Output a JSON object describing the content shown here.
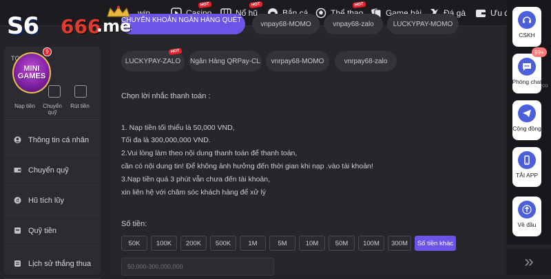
{
  "nav": {
    "logo": {
      "part1": "S6",
      "part2": "666",
      "part3": ".me"
    },
    "items": [
      {
        "label": "win",
        "icon": "slot-icon",
        "hot": false
      },
      {
        "label": "Casino",
        "icon": "play-icon",
        "hot": true
      },
      {
        "label": "Nổ hũ",
        "icon": "slot-icon",
        "hot": true
      },
      {
        "label": "Bắn cá",
        "icon": "fish-icon",
        "hot": false
      },
      {
        "label": "Thể thao",
        "icon": "sports-icon",
        "hot": true
      },
      {
        "label": "Game bài",
        "icon": "cards-icon",
        "hot": false
      },
      {
        "label": "Đá gà",
        "icon": "rooster-icon",
        "hot": false
      },
      {
        "label": "Ưu đãi",
        "icon": "wallet-icon",
        "hot": false
      }
    ],
    "hot_label": "HOT"
  },
  "sidebar": {
    "partial_label": "TC",
    "minigames": {
      "line1": "MINI",
      "line2": "GAMES",
      "badge": "9"
    },
    "wallet_actions": [
      "Nạp tiền",
      "Chuyển quỹ",
      "Rút tiền"
    ],
    "menu": [
      {
        "label": "Thông tin cá nhân",
        "icon": "user-icon"
      },
      {
        "label": "Chuyển quỹ",
        "icon": "transfer-icon"
      },
      {
        "label": "Hũ tích lũy",
        "icon": "piggy-icon"
      },
      {
        "label": "Quỹ tiền",
        "icon": "fund-icon"
      },
      {
        "label": "Lịch sử thắng thua",
        "icon": "history-icon"
      }
    ]
  },
  "payment_methods": {
    "row1": [
      {
        "label": "CHUYỂN KHOẢN NGÂN HÀNG QUÉT MÃ",
        "active": true
      },
      {
        "label": "vnpay68-MOMO",
        "active": false
      },
      {
        "label": "vnpay68-zalo",
        "active": false
      },
      {
        "label": "LUCKYPAY-MOMO",
        "active": false
      }
    ],
    "row2": [
      {
        "label": "LUCKYPAY-ZALO",
        "hot": true
      },
      {
        "label": "Ngân Hàng QRPay-CL",
        "hot": false
      },
      {
        "label": "vnrpay68-MOMO",
        "hot": false
      },
      {
        "label": "vnrpay68-zalo",
        "hot": false
      }
    ]
  },
  "reminder": {
    "title": "Chọn lời nhắc thanh toán :",
    "lines": [
      "1. Nạp tiền tối thiểu là 50,000 VND,",
      "Tối đa là 300,000,000 VND.",
      "2.Vui lòng làm theo nội dung thanh toán để thanh toán,",
      "cần có nội dung tin! Để không ảnh hưởng đến thời gian khi nạp .vào tài khoản!",
      "3.Nạp tiền quá 3 phút vẫn chưa đến tài khoản,",
      "xin liên hệ với chăm sóc khách hàng để xử lý"
    ]
  },
  "amount": {
    "label": "Số tiền:",
    "options": [
      "50K",
      "100K",
      "200K",
      "500K",
      "1M",
      "5M",
      "10M",
      "50M",
      "100M",
      "300M",
      "Số tiền khác"
    ],
    "active_index": 10,
    "input_placeholder": "50,000-300,000,000"
  },
  "right_panel": {
    "buttons": [
      {
        "label": "CSKH",
        "icon": "headset-icon"
      },
      {
        "label": "Phòng chat",
        "icon": "chat-icon",
        "badge": "99+"
      },
      {
        "label": "Cộng đồng",
        "icon": "telegram-icon"
      },
      {
        "label": "TẢI APP",
        "icon": "phone-icon"
      },
      {
        "label": "Về đầu",
        "icon": "arrow-up-icon"
      }
    ],
    "next": "»",
    "partial_text": "co"
  }
}
